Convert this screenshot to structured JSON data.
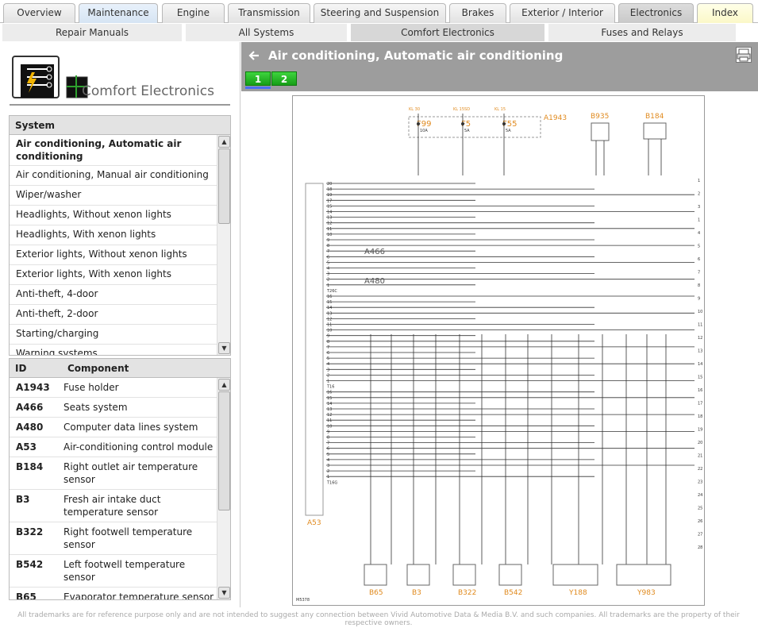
{
  "tabs": [
    {
      "label": "Overview",
      "state": "normal"
    },
    {
      "label": "Maintenance",
      "state": "maintenance"
    },
    {
      "label": "Engine",
      "state": "normal"
    },
    {
      "label": "Transmission",
      "state": "normal"
    },
    {
      "label": "Steering and Suspension",
      "state": "normal"
    },
    {
      "label": "Brakes",
      "state": "normal"
    },
    {
      "label": "Exterior / Interior",
      "state": "normal"
    },
    {
      "label": "Electronics",
      "state": "active"
    },
    {
      "label": "Index",
      "state": "index"
    }
  ],
  "subtabs": [
    {
      "label": "Repair Manuals"
    },
    {
      "label": "All Systems"
    },
    {
      "label": "Comfort Electronics",
      "active": true
    },
    {
      "label": "Fuses and Relays"
    }
  ],
  "left": {
    "section_title": "Comfort Electronics",
    "system_header": "System",
    "systems": [
      {
        "label": "Air conditioning, Automatic air conditioning",
        "selected": true
      },
      {
        "label": "Air conditioning, Manual air conditioning"
      },
      {
        "label": "Wiper/washer"
      },
      {
        "label": "Headlights, Without xenon lights"
      },
      {
        "label": "Headlights, With xenon lights"
      },
      {
        "label": "Exterior lights, Without xenon lights"
      },
      {
        "label": "Exterior lights, With xenon lights"
      },
      {
        "label": "Anti-theft, 4-door"
      },
      {
        "label": "Anti-theft, 2-door"
      },
      {
        "label": "Starting/charging"
      },
      {
        "label": "Warning systems"
      }
    ],
    "component_header_id": "ID",
    "component_header_name": "Component",
    "components": [
      {
        "id": "A1943",
        "name": "Fuse holder"
      },
      {
        "id": "A466",
        "name": "Seats system"
      },
      {
        "id": "A480",
        "name": "Computer data lines system"
      },
      {
        "id": "A53",
        "name": "Air-conditioning control module"
      },
      {
        "id": "B184",
        "name": "Right outlet air temperature sensor"
      },
      {
        "id": "B3",
        "name": "Fresh air intake duct temperature sensor"
      },
      {
        "id": "B322",
        "name": "Right footwell temperature sensor"
      },
      {
        "id": "B542",
        "name": "Left footwell temperature sensor"
      },
      {
        "id": "B65",
        "name": "Evaporator temperature sensor"
      }
    ]
  },
  "right": {
    "title": "Air conditioning, Automatic air conditioning",
    "pages": [
      "1",
      "2"
    ],
    "active_page": "1"
  },
  "diagram": {
    "fuse_holder": "A1943",
    "fuses": [
      {
        "name": "F99",
        "rating": "10A",
        "kl": "KL 30"
      },
      {
        "name": "F5",
        "rating": "5A",
        "kl": "KL 15SD"
      },
      {
        "name": "F55",
        "rating": "5A",
        "kl": "KL 15"
      }
    ],
    "top_components": [
      "B935",
      "B184"
    ],
    "module": "A53",
    "subsystems": [
      "A466",
      "A480"
    ],
    "bottom_components": [
      "B65",
      "B3",
      "B322",
      "B542",
      "Y188",
      "Y983"
    ],
    "left_pins": [
      "20",
      "18",
      "19",
      "17",
      "15",
      "14",
      "13",
      "12",
      "11",
      "10",
      "9",
      "8",
      "7",
      "6",
      "5",
      "4",
      "3",
      "2",
      "1",
      "T26C",
      "16",
      "15",
      "14",
      "13",
      "12",
      "11",
      "10",
      "9",
      "8",
      "7",
      "6",
      "5",
      "4",
      "3",
      "2",
      "1",
      "T16",
      "16",
      "15",
      "14",
      "13",
      "12",
      "11",
      "10",
      "9",
      "8",
      "7",
      "6",
      "5",
      "4",
      "3",
      "2",
      "1",
      "T16G"
    ],
    "right_refs": [
      "1",
      "2",
      "3",
      "1",
      "4",
      "5",
      "6",
      "7",
      "8",
      "9",
      "10",
      "11",
      "12",
      "13",
      "14",
      "15",
      "16",
      "17",
      "18",
      "19",
      "20",
      "21",
      "22",
      "23",
      "24",
      "25",
      "26",
      "27",
      "28"
    ],
    "drawing_id": "M5378"
  },
  "colors": {
    "tab_maintenance": "#d6e4f3",
    "tab_active": "#c9c9c9",
    "tab_index": "#fbf8c8",
    "header_bg": "#9d9d9d",
    "page_button": "#169e16",
    "component_label": "#e08a1e",
    "wire_label": "#1a3cc8",
    "optional_label": "#c040c0"
  },
  "footer": "All trademarks are for reference purpose only and are not intended to suggest any connection between Vivid Automotive Data & Media B.V. and such companies. All trademarks are the property of their respective owners."
}
